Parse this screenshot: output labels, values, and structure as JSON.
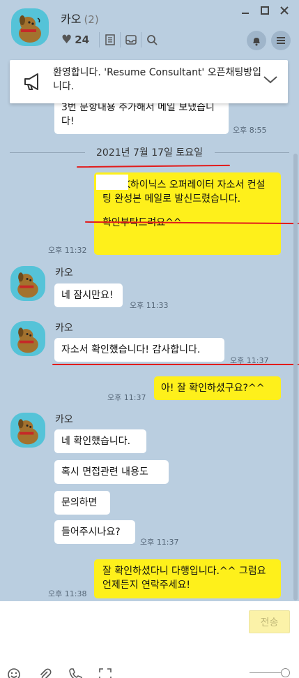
{
  "header": {
    "title": "카오",
    "member_count": "(2)",
    "likes": "24"
  },
  "notice": {
    "text": "환영합니다. 'Resume Consultant' 오픈채팅방입니다."
  },
  "messages": {
    "m1": {
      "text": "3번 문항내용 추가해서 메일 보냈습니다!",
      "time": "오후 8:55"
    },
    "date": "2021년 7월 17일 토요일",
    "m2": {
      "text": "님, SK하이닉스 오퍼레이터 자소서 컨설팅 완성본 메일로 발신드렸습니다.",
      "text2": "확인부탁드려요^^",
      "time": "오후 11:32"
    },
    "m3": {
      "sender": "카오",
      "text": "네 잠시만요!",
      "time": "오후 11:33"
    },
    "m4": {
      "sender": "카오",
      "text": "자소서 확인했습니다! 감사합니다.",
      "time": "오후 11:37"
    },
    "m5": {
      "text": "아! 잘 확인하셨구요?^^",
      "time": "오후 11:37"
    },
    "m6": {
      "sender": "카오",
      "lines": [
        "네 확인했습니다.",
        "혹시 면접관련 내용도",
        "문의하면",
        "들어주시나요?"
      ],
      "time": "오후 11:37"
    },
    "m7": {
      "text": "잘 확인하셨다니 다행입니다.^^ 그럼요 언제든지 연락주세요!",
      "time": "오후 11:38"
    }
  },
  "input": {
    "send_label": "전송"
  },
  "colors": {
    "background": "#bacee0",
    "my_bubble": "#fef01b",
    "other_bubble": "#ffffff",
    "annotation": "#e21b1b"
  }
}
